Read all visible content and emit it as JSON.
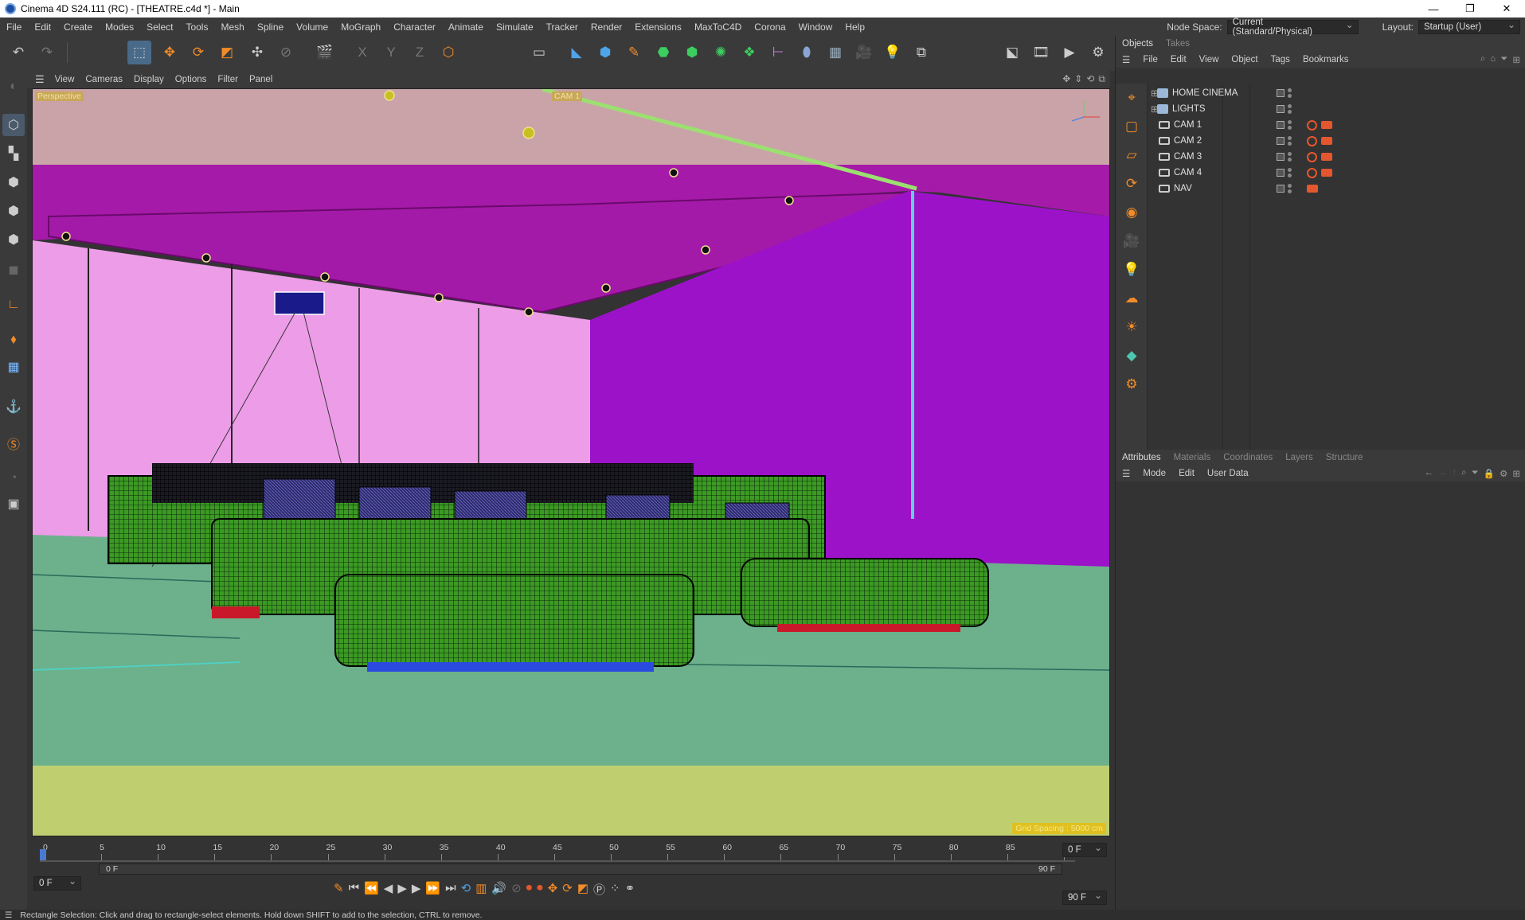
{
  "window": {
    "title": "Cinema 4D S24.111 (RC) - [THEATRE.c4d *] - Main",
    "minimize": "—",
    "restore": "❐",
    "close": "✕"
  },
  "menubar": {
    "items": [
      "File",
      "Edit",
      "Create",
      "Modes",
      "Select",
      "Tools",
      "Mesh",
      "Spline",
      "Volume",
      "MoGraph",
      "Character",
      "Animate",
      "Simulate",
      "Tracker",
      "Render",
      "Extensions",
      "MaxToC4D",
      "Corona",
      "Window",
      "Help"
    ],
    "node_space_label": "Node Space:",
    "node_space_value": "Current (Standard/Physical)",
    "layout_label": "Layout:",
    "layout_value": "Startup (User)"
  },
  "viewport": {
    "menu": [
      "View",
      "Cameras",
      "Display",
      "Options",
      "Filter",
      "Panel"
    ],
    "view_name": "Perspective",
    "camera_label": "CAM 1",
    "grid_spacing": "Grid Spacing : 5000 cm",
    "colors": {
      "ceiling_far": "#c9a3a8",
      "ceiling": "#a51aa8",
      "wall_left": "#ed9ce8",
      "wall_right": "#9c12c8",
      "floor": "#6db08c",
      "foreground": "#bfcf70",
      "sofa": "#3d9a22"
    }
  },
  "timeline": {
    "ticks": [
      "0",
      "5",
      "10",
      "15",
      "20",
      "25",
      "30",
      "35",
      "40",
      "45",
      "50",
      "55",
      "60",
      "65",
      "70",
      "75",
      "80",
      "85",
      "90"
    ],
    "current_frame": "0 F",
    "start_frame": "0 F",
    "range_start": "0 F",
    "range_end": "90 F",
    "end_frame": "90 F",
    "end_frame2": "90 F"
  },
  "objects_panel": {
    "tabs": [
      "Objects",
      "Takes"
    ],
    "menu": [
      "File",
      "Edit",
      "View",
      "Object",
      "Tags",
      "Bookmarks"
    ],
    "items": [
      {
        "name": "HOME CINEMA",
        "type": "null"
      },
      {
        "name": "LIGHTS",
        "type": "null"
      },
      {
        "name": "CAM 1",
        "type": "camera"
      },
      {
        "name": "CAM 2",
        "type": "camera"
      },
      {
        "name": "CAM 3",
        "type": "camera"
      },
      {
        "name": "CAM 4",
        "type": "camera"
      },
      {
        "name": "NAV",
        "type": "camera"
      }
    ]
  },
  "attributes_panel": {
    "tabs": [
      "Attributes",
      "Materials",
      "Coordinates",
      "Layers",
      "Structure"
    ],
    "menu": [
      "Mode",
      "Edit",
      "User Data"
    ]
  },
  "status": {
    "text": "Rectangle Selection: Click and drag to rectangle-select elements. Hold down SHIFT to add to the selection, CTRL to remove."
  }
}
